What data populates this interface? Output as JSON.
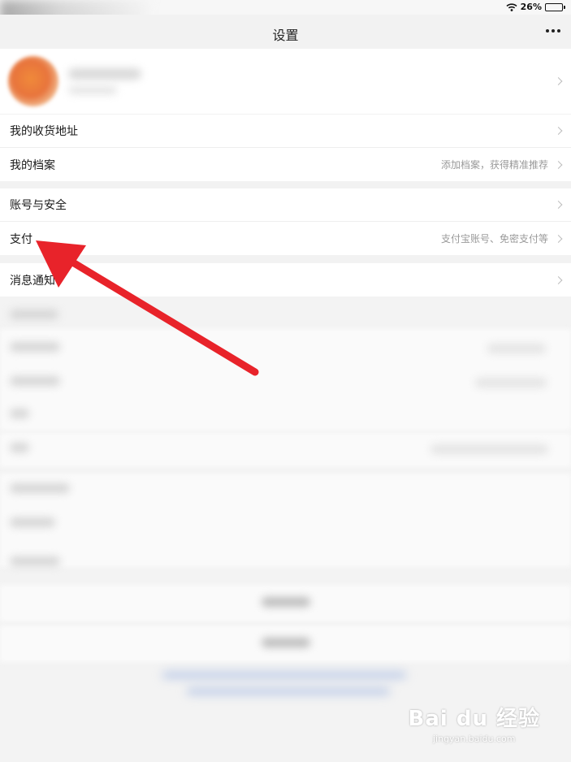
{
  "status_bar": {
    "battery": "26%"
  },
  "nav": {
    "title": "设置"
  },
  "menu_groups": [
    [
      {
        "label": "我的收货地址",
        "hint": ""
      },
      {
        "label": "我的档案",
        "hint": "添加档案，获得精准推荐"
      }
    ],
    [
      {
        "label": "账号与安全",
        "hint": ""
      },
      {
        "label": "支付",
        "hint": "支付宝账号、免密支付等"
      }
    ],
    [
      {
        "label": "消息通知",
        "hint": ""
      }
    ]
  ],
  "watermark": {
    "brand": "Bai du 经验",
    "url": "jingyan.baidu.com"
  },
  "colors": {
    "arrow": "#e8232a",
    "hint_text": "#9a9a9a"
  }
}
